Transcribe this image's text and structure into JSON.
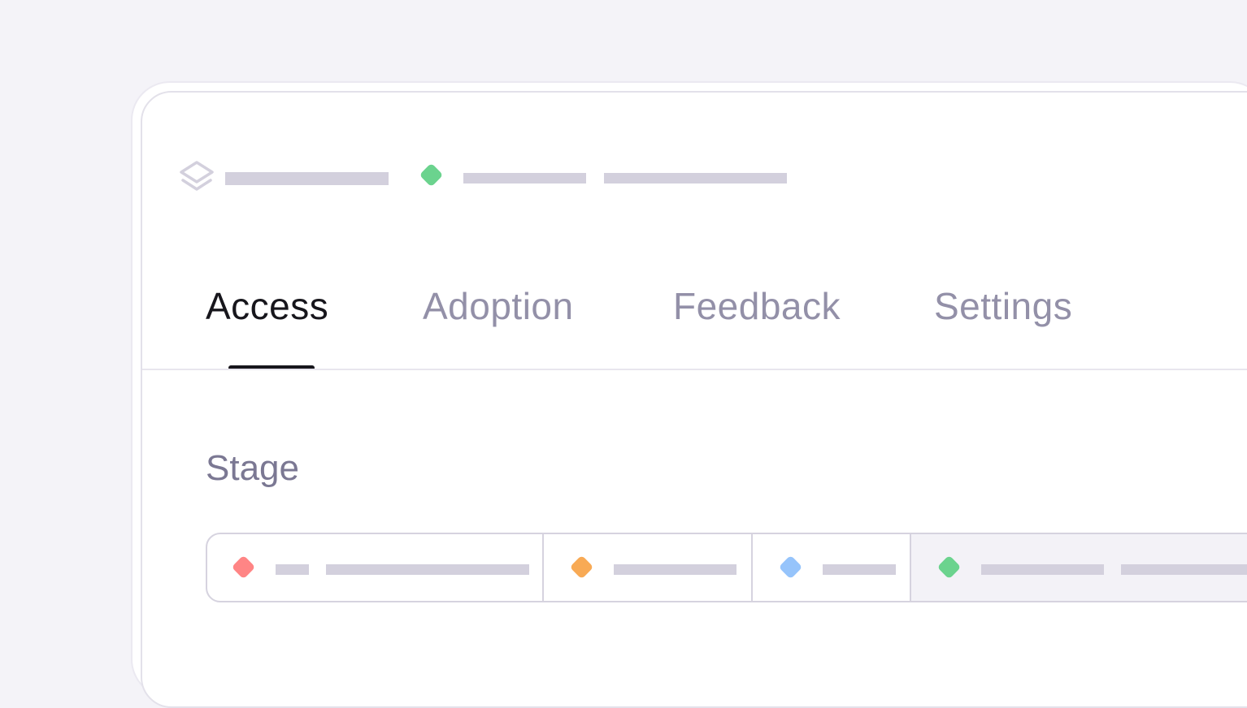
{
  "colors": {
    "accent_green": "#6bd38e",
    "red": "#ff8585",
    "orange": "#f8aa55",
    "blue": "#96c4fb",
    "skeleton": "#d3d0dd",
    "tab_inactive": "#9390a8",
    "tab_active": "#17161c"
  },
  "breadcrumb": {
    "icon": "layers-icon",
    "status_icon": "green-diamond-icon"
  },
  "tabs": [
    {
      "label": "Access",
      "active": true
    },
    {
      "label": "Adoption",
      "active": false
    },
    {
      "label": "Feedback",
      "active": false
    },
    {
      "label": "Settings",
      "active": false
    }
  ],
  "stage": {
    "label": "Stage",
    "segments": [
      {
        "icon": "red-diamond-icon",
        "selected": false
      },
      {
        "icon": "orange-diamond-icon",
        "selected": false
      },
      {
        "icon": "blue-diamond-icon",
        "selected": false
      },
      {
        "icon": "green-diamond-icon",
        "selected": true
      }
    ]
  }
}
